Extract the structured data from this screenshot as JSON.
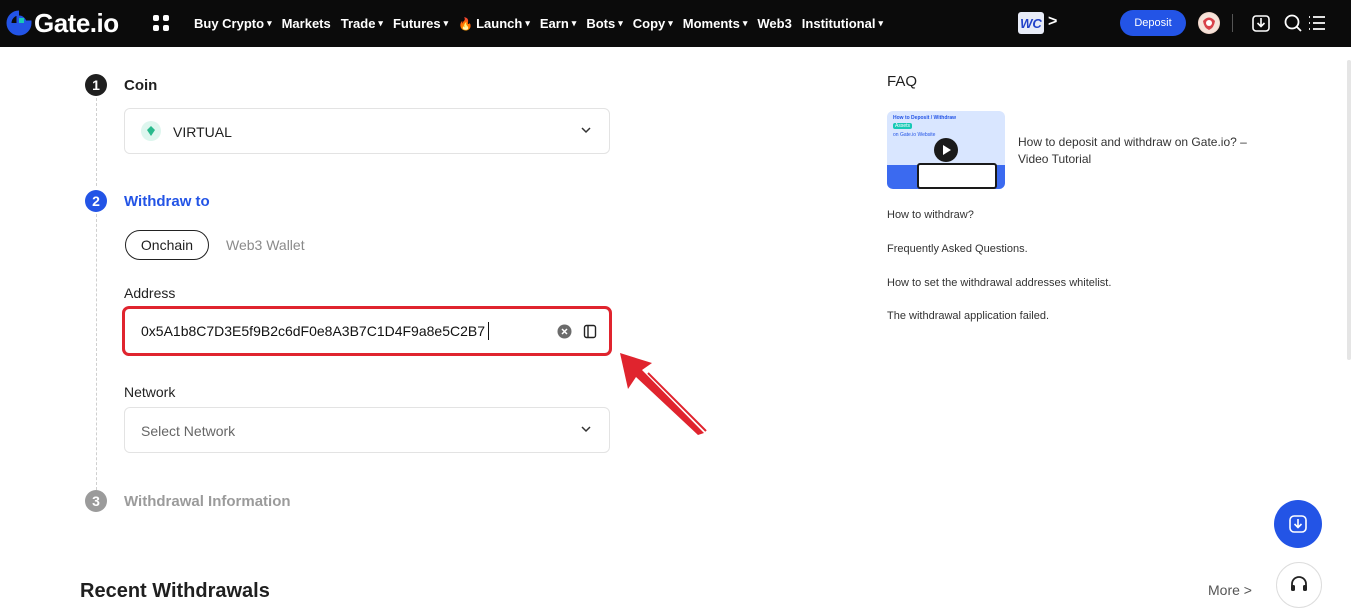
{
  "nav": {
    "brand": "Gate.io",
    "items": [
      {
        "label": "Buy Crypto",
        "caret": true
      },
      {
        "label": "Markets",
        "caret": false
      },
      {
        "label": "Trade",
        "caret": true
      },
      {
        "label": "Futures",
        "caret": true
      },
      {
        "label": "Launch",
        "caret": true,
        "flame": true
      },
      {
        "label": "Earn",
        "caret": true
      },
      {
        "label": "Bots",
        "caret": true
      },
      {
        "label": "Copy",
        "caret": true
      },
      {
        "label": "Moments",
        "caret": true
      },
      {
        "label": "Web3",
        "caret": false
      },
      {
        "label": "Institutional",
        "caret": true
      }
    ],
    "caret_glyph": "▾",
    "flame_glyph": "🔥",
    "wc_label": "WC",
    "more_arrow": ">",
    "deposit_label": "Deposit"
  },
  "steps": {
    "coin": {
      "num": "1",
      "title": "Coin",
      "selected_coin": "VIRTUAL"
    },
    "withdraw_to": {
      "num": "2",
      "title": "Withdraw to",
      "tabs": {
        "onchain": "Onchain",
        "web3": "Web3 Wallet"
      },
      "address_label": "Address",
      "address_value": "0x5A1b8C7D3E5f9B2c6dF0e8A3B7C1D4F9a8e5C2B7",
      "network_label": "Network",
      "network_placeholder": "Select Network"
    },
    "info": {
      "num": "3",
      "title": "Withdrawal Information"
    }
  },
  "faq": {
    "title": "FAQ",
    "thumb_caption": "How to Deposit / Withdraw",
    "thumb_tag": "Assets",
    "thumb_sub": "on Gate.io Website",
    "video_label": "How to deposit and withdraw on Gate.io? – Video Tutorial",
    "links": [
      "How to withdraw?",
      "Frequently Asked Questions.",
      "How to set the withdrawal addresses whitelist.",
      "The withdrawal application failed."
    ]
  },
  "recent": {
    "title": "Recent Withdrawals",
    "more": "More >"
  },
  "colors": {
    "brand_blue": "#2354e6",
    "highlight_red": "#e0242e",
    "logo_teal": "#17c9b6"
  }
}
